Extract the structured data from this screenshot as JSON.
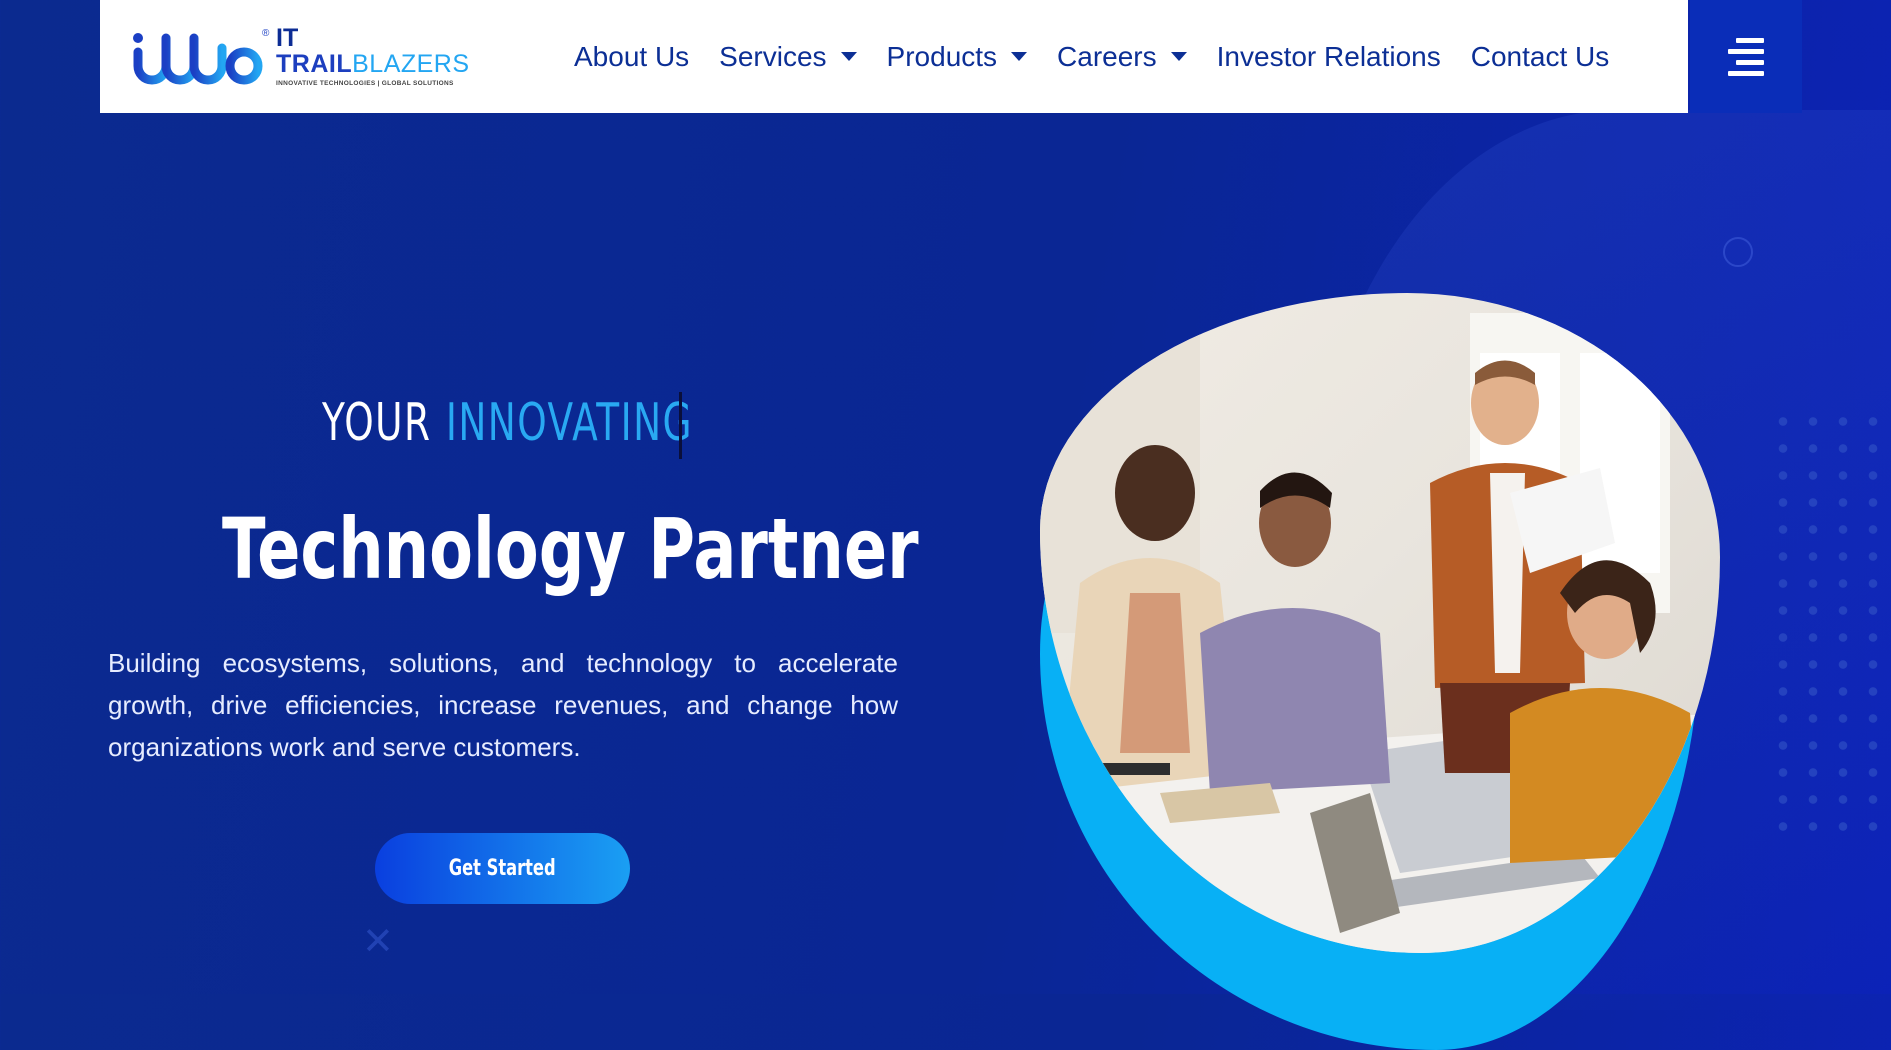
{
  "brand": {
    "logo_mark": "ittb",
    "logo_line1": "IT",
    "logo_line2_bold": "TRAIL",
    "logo_line2_light": "BLAZERS",
    "tagline": "INNOVATIVE TECHNOLOGIES | GLOBAL SOLUTIONS",
    "registered_mark": "®"
  },
  "nav": {
    "items": [
      {
        "label": "About Us",
        "has_dropdown": false
      },
      {
        "label": "Services",
        "has_dropdown": true
      },
      {
        "label": "Products",
        "has_dropdown": true
      },
      {
        "label": "Careers",
        "has_dropdown": true
      },
      {
        "label": "Investor Relations",
        "has_dropdown": false
      },
      {
        "label": "Contact Us",
        "has_dropdown": false
      }
    ],
    "menu_icon": "hamburger-menu-icon"
  },
  "hero": {
    "line1_word1": "YOUR",
    "line1_word2": "INNOVATING",
    "title": "Technology Partner",
    "description": "Building ecosystems, solutions, and technology to accelerate growth, drive efficiencies, increase revenues, and change how organizations work and serve customers.",
    "cta_label": "Get Started"
  },
  "colors": {
    "background": "#0a2694",
    "accent": "#29a9f2",
    "nav_text": "#0c2f95",
    "menu_button": "#0a2db8",
    "blob": "#08b0f5"
  }
}
